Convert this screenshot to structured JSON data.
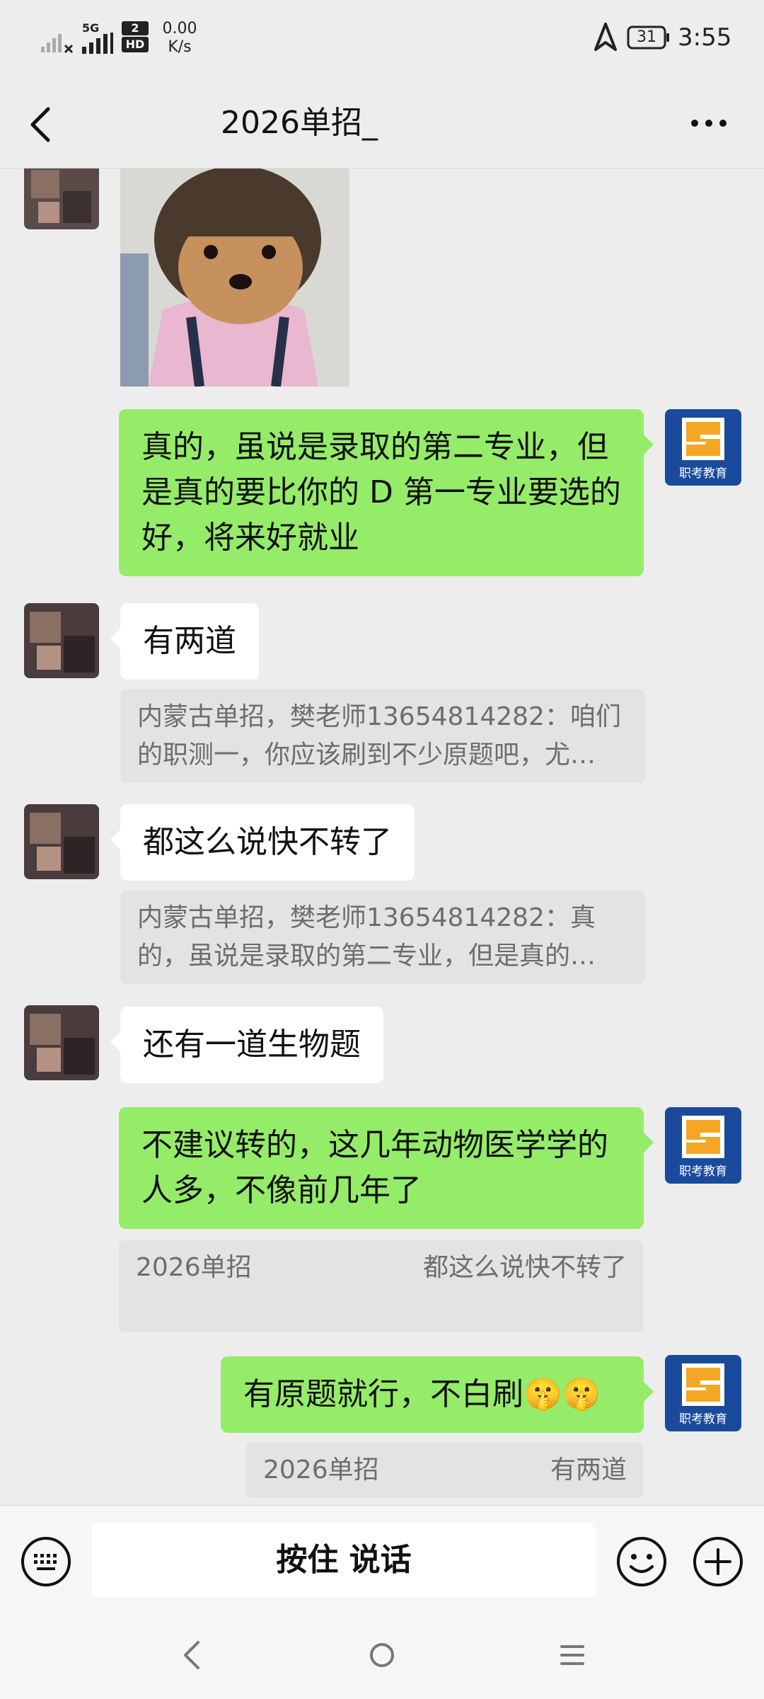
{
  "status_bar": {
    "network": "5G",
    "hd_badge": "HD",
    "sim_slot": "2",
    "speed_value": "0.00",
    "speed_unit": "K/s",
    "battery": "31",
    "time": "3:55"
  },
  "header": {
    "title": "2026单招_"
  },
  "messages": [
    {
      "id": "m1",
      "side": "right",
      "text": "真的，虽说是录取的第二专业，但是真的要比你的 D 第一专业要选的好，将来好就业"
    },
    {
      "id": "m2",
      "side": "left",
      "text": "有两道",
      "quote": "内蒙古单招，樊老师13654814282：咱们的职测一，你应该刷到不少原题吧，尤…"
    },
    {
      "id": "m3",
      "side": "left",
      "text": "都这么说快不转了",
      "quote": "内蒙古单招，樊老师13654814282：真的，虽说是录取的第二专业，但是真的…"
    },
    {
      "id": "m4",
      "side": "left",
      "text": "还有一道生物题"
    },
    {
      "id": "m5",
      "side": "right",
      "text": "不建议转的，这几年动物医学学的人多，不像前几年了",
      "quote_name": "2026单招",
      "quote_text": "都这么说快不转了"
    },
    {
      "id": "m6",
      "side": "right",
      "text": "有原题就行，不白刷🤫🤫",
      "quote_name": "2026单招",
      "quote_text": "有两道"
    }
  ],
  "avatar_logo_text": "职考教育",
  "input_bar": {
    "hold_to_talk": "按住 说话"
  },
  "colors": {
    "background": "#ededed",
    "bubble_self": "#95ec69",
    "bubble_other": "#ffffff",
    "logo_blue": "#1a4a9c",
    "logo_orange": "#f5a623"
  }
}
